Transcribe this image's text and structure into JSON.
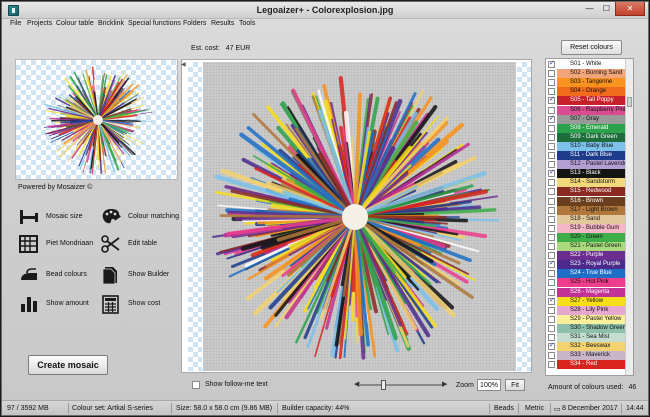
{
  "window": {
    "title": "Legoaizer+ - Colorexplosion.jpg",
    "min_glyph": "—",
    "max_glyph": "☐",
    "close_glyph": "✕"
  },
  "menu": [
    "File",
    "Projects",
    "Colour table",
    "Bricklink",
    "Special functions",
    "Folders",
    "Results",
    "Tools"
  ],
  "cost": {
    "label": "Est. cost:",
    "value": "47 EUR"
  },
  "reset_button": "Reset colours",
  "powered_by": "Powered by Mosaizer ©",
  "tools": [
    {
      "label": "Mosaic size",
      "icon": "mosaic-size-icon"
    },
    {
      "label": "Colour matching",
      "icon": "palette-icon"
    },
    {
      "label": "Piet Mondriaan",
      "icon": "grid-icon"
    },
    {
      "label": "Edit table",
      "icon": "scissors-icon"
    },
    {
      "label": "Bead colours",
      "icon": "iron-icon"
    },
    {
      "label": "Show Builder",
      "icon": "document-icon"
    },
    {
      "label": "Show amount",
      "icon": "bar-chart-icon"
    },
    {
      "label": "Show cost",
      "icon": "calculator-icon"
    }
  ],
  "create_button": "Create mosaic",
  "palette": [
    {
      "name": "S01 - White",
      "color": "#ffffff",
      "checked": true
    },
    {
      "name": "S02 - Burning Sand",
      "color": "#f2a57a",
      "checked": false
    },
    {
      "name": "S03 - Tangerine",
      "color": "#f7931e",
      "checked": false
    },
    {
      "name": "S04 - Orange",
      "color": "#f26a1b",
      "checked": false
    },
    {
      "name": "S05 - Tall Poppy",
      "color": "#c8202a",
      "checked": true
    },
    {
      "name": "S06 - Raspberry Pink",
      "color": "#d94c91",
      "checked": false
    },
    {
      "name": "S07 - Gray",
      "color": "#9a9a9a",
      "checked": true
    },
    {
      "name": "S08 - Emerald",
      "color": "#2ca24a",
      "checked": false
    },
    {
      "name": "S09 - Dark Green",
      "color": "#1d6e3b",
      "checked": false
    },
    {
      "name": "S10 - Baby Blue",
      "color": "#7cc1ea",
      "checked": false
    },
    {
      "name": "S11 - Dark Blue",
      "color": "#1f3c8c",
      "checked": false
    },
    {
      "name": "S12 - Pastel Lavender",
      "color": "#b49fd3",
      "checked": false
    },
    {
      "name": "S13 - Black",
      "color": "#141414",
      "checked": true
    },
    {
      "name": "S14 - Sandstorm",
      "color": "#f1d87b",
      "checked": false
    },
    {
      "name": "S15 - Redwood",
      "color": "#8a2a22",
      "checked": false
    },
    {
      "name": "S16 - Brown",
      "color": "#6b3f1d",
      "checked": false
    },
    {
      "name": "S17 - Light Brown",
      "color": "#b0783a",
      "checked": false
    },
    {
      "name": "S18 - Sand",
      "color": "#e3c89c",
      "checked": false
    },
    {
      "name": "S19 - Bubble Gum",
      "color": "#f6b6c9",
      "checked": false
    },
    {
      "name": "S20 - Green",
      "color": "#3dae49",
      "checked": false
    },
    {
      "name": "S21 - Pastel Green",
      "color": "#a8d97a",
      "checked": false
    },
    {
      "name": "S22 - Purple",
      "color": "#6b2d8f",
      "checked": false
    },
    {
      "name": "S23 - Royal Purple",
      "color": "#4c2a8c",
      "checked": true
    },
    {
      "name": "S24 - True Blue",
      "color": "#1e6fc5",
      "checked": false
    },
    {
      "name": "S25 - Hot Pink",
      "color": "#ee3d8d",
      "checked": false
    },
    {
      "name": "S26 - Magenta",
      "color": "#c23296",
      "checked": false
    },
    {
      "name": "S27 - Yellow",
      "color": "#f6de19",
      "checked": true
    },
    {
      "name": "S28 - Lily Pink",
      "color": "#e5a8cf",
      "checked": false
    },
    {
      "name": "S29 - Pastel Yellow",
      "color": "#fbf09a",
      "checked": false
    },
    {
      "name": "S30 - Shadow Green",
      "color": "#8dbfad",
      "checked": false
    },
    {
      "name": "S31 - Sea Mist",
      "color": "#c3ddd1",
      "checked": false
    },
    {
      "name": "S32 - Beeswax",
      "color": "#f3d26f",
      "checked": true
    },
    {
      "name": "S33 - Maverick",
      "color": "#c8b6c8",
      "checked": false
    },
    {
      "name": "S34 - Red",
      "color": "#d8231f",
      "checked": false
    }
  ],
  "colours_used": {
    "label": "Amount of colours used:",
    "value": "46"
  },
  "follow_me": "Show follow-me text",
  "zoom": {
    "label": "Zoom",
    "value": "100%",
    "fit": "Fit",
    "slider_level": 0.28
  },
  "status": {
    "memory": "97 / 3592 MB",
    "colour_set": "Colour set: Artkal S-series",
    "size": "Size: 58.0 x 58.0 cm (9.86 MB)",
    "builder": "Builder capacity: 44%",
    "beads": "Beads",
    "metric": "Metric",
    "date": "8 December 2017",
    "time": "14:44"
  }
}
